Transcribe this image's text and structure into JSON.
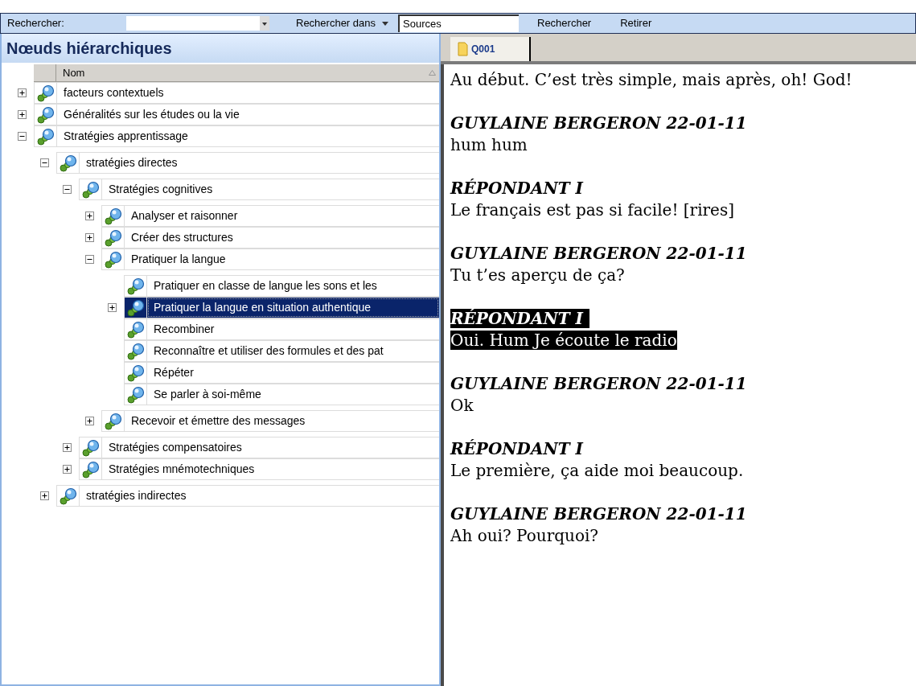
{
  "toolbar": {
    "search_label": "Rechercher:",
    "search_in": "Rechercher dans",
    "scope_value": "Sources",
    "buttons": [
      "Rechercher",
      "Retirer"
    ]
  },
  "panel": {
    "title": "Nœuds hiérarchiques",
    "column": "Nom"
  },
  "tree": [
    {
      "label": "facteurs contextuels",
      "expanded": false,
      "selected": false
    },
    {
      "label": "Généralités sur les études ou la vie",
      "expanded": false,
      "selected": false
    },
    {
      "label": "Stratégies apprentissage",
      "expanded": true,
      "selected": false,
      "children": [
        {
          "label": "stratégies directes",
          "expanded": true,
          "selected": false,
          "children": [
            {
              "label": "Stratégies cognitives",
              "expanded": true,
              "selected": false,
              "children": [
                {
                  "label": "Analyser et raisonner",
                  "expanded": false,
                  "selected": false
                },
                {
                  "label": "Créer des structures",
                  "expanded": false,
                  "selected": false
                },
                {
                  "label": "Pratiquer la langue",
                  "expanded": true,
                  "selected": false,
                  "children": [
                    {
                      "label": "Pratiquer en classe de langue les sons et les",
                      "selected": false
                    },
                    {
                      "label": "Pratiquer la langue en situation authentique",
                      "expanded": false,
                      "selected": true
                    },
                    {
                      "label": "Recombiner",
                      "selected": false
                    },
                    {
                      "label": "Reconnaître et utiliser des formules et des pat",
                      "selected": false
                    },
                    {
                      "label": "Répéter",
                      "selected": false
                    },
                    {
                      "label": "Se parler à soi-même",
                      "selected": false
                    }
                  ]
                },
                {
                  "label": "Recevoir et émettre des messages",
                  "expanded": false,
                  "selected": false
                }
              ]
            },
            {
              "label": "Stratégies compensatoires",
              "expanded": false,
              "selected": false
            },
            {
              "label": "Stratégies mnémotechniques",
              "expanded": false,
              "selected": false
            }
          ]
        },
        {
          "label": "stratégies indirectes",
          "expanded": false,
          "selected": false
        }
      ]
    }
  ],
  "document_tab": {
    "label": "Q001",
    "selected": true
  },
  "transcript": [
    {
      "text": "Au début. C’est très simple, mais après, oh! God!",
      "selected": false
    },
    {
      "speaker": "GUYLAINE BERGERON 22-01-11",
      "text": "hum hum",
      "selected": false
    },
    {
      "speaker": "RÉPONDANT I",
      "text": "Le français est pas si facile! [rires]",
      "selected": false
    },
    {
      "speaker": "GUYLAINE BERGERON 22-01-11",
      "text": "Tu t’es aperçu de ça?",
      "selected": false
    },
    {
      "speaker": "RÉPONDANT I",
      "text": "Oui. Hum Je écoute le radio",
      "selected": true
    },
    {
      "speaker": "GUYLAINE BERGERON 22-01-11",
      "text": "Ok",
      "selected": false
    },
    {
      "speaker": "RÉPONDANT I",
      "text": "Le première, ça aide moi beaucoup.",
      "selected": false
    },
    {
      "speaker": "GUYLAINE BERGERON 22-01-11",
      "text": "Ah oui? Pourquoi?",
      "selected": false
    }
  ]
}
